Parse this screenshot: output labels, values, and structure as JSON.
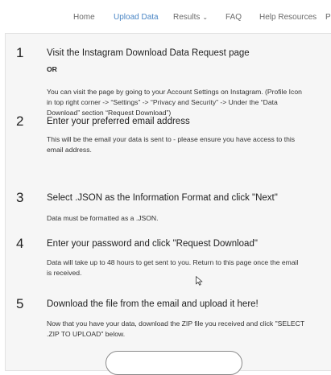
{
  "nav": {
    "items": [
      {
        "label": "Home"
      },
      {
        "label": "Upload Data",
        "active": true
      },
      {
        "label": "Results",
        "dropdown": true
      },
      {
        "label": "FAQ"
      },
      {
        "label": "Help Resources"
      },
      {
        "label": "P"
      }
    ],
    "active_color": "#4a86c5",
    "chevron_icon": "chevron-down-icon"
  },
  "steps": [
    {
      "number": "1",
      "title": "Visit the Instagram Download Data Request page",
      "or_label": "OR",
      "body": "You can visit the page by going to your Account Settings on Instagram. (Profile Icon in top right corner -> “Settings” -> “Privacy and Security” -> Under the “Data Download” section “Request Download”)"
    },
    {
      "number": "2",
      "title": "Enter your preferred email address",
      "body": "This will be the email your data is sent to - please ensure you have access to this email address."
    },
    {
      "number": "3",
      "title": "Select .JSON as the Information Format and click \"Next\"",
      "body": "Data must be formatted as a .JSON."
    },
    {
      "number": "4",
      "title": "Enter your password and click \"Request Download\"",
      "body": "Data will take up to 48 hours to get sent to you. Return to this page once the email is received."
    },
    {
      "number": "5",
      "title": "Download the file from the email and upload it here!",
      "body": "Now that you have your data, download the ZIP file you received and click \"SELECT .ZIP TO UPLOAD\" below."
    }
  ]
}
